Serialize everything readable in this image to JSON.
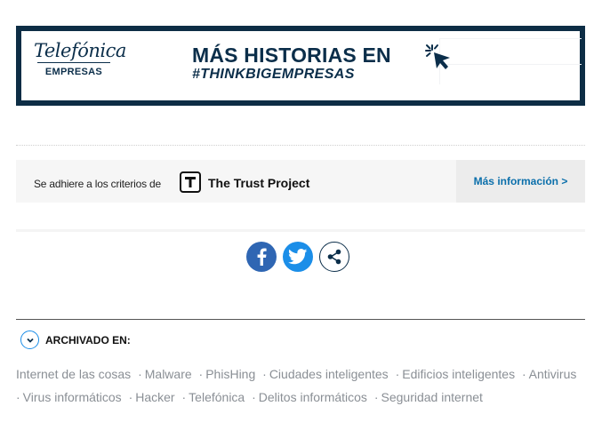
{
  "banner": {
    "brand": "Telefónica",
    "brand_sub": "EMPRESAS",
    "headline_1": "MÁS HISTORIAS EN",
    "headline_2": "#THINKBIGEMPRESAS",
    "icon": "click-cursor-icon",
    "color": "#0b2e4a"
  },
  "trust": {
    "text": "Se adhiere a los criterios de",
    "logo_letter": "T",
    "name": "The Trust Project",
    "more": "Más información >"
  },
  "share": {
    "icons": [
      "facebook-icon",
      "twitter-icon",
      "share-icon"
    ],
    "colors": {
      "facebook": "#2f66b3",
      "twitter": "#1b8ee8"
    }
  },
  "archive": {
    "title": "ARCHIVADO EN:",
    "icon": "chevron-down-icon",
    "tags": [
      "Internet de las cosas",
      "Malware",
      "PhisHing",
      "Ciudades inteligentes",
      "Edificios inteligentes",
      "Antivirus",
      "Virus informáticos",
      "Hacker",
      "Telefónica",
      "Delitos informáticos",
      "Seguridad internet"
    ]
  }
}
